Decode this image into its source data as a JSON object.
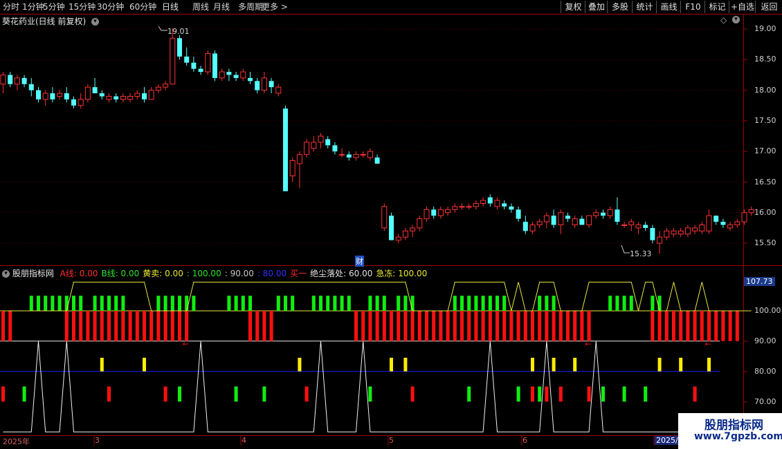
{
  "toolbar": {
    "left": [
      "分时",
      "1分钟",
      "5分钟",
      "15分钟",
      "30分钟",
      "60分钟",
      "日线",
      "周线",
      "月线",
      "多周期",
      "更多"
    ],
    "right": [
      "复权",
      "叠加",
      "多股",
      "统计",
      "画线",
      "F10",
      "标记",
      "+自选",
      "返回"
    ]
  },
  "stock": {
    "title": "葵花药业(日线 前复权)",
    "high_marker": "19.01",
    "low_marker": "15.33",
    "fin_marker": "财"
  },
  "price_axis": [
    "19.00",
    "18.50",
    "18.00",
    "17.50",
    "17.00",
    "16.50",
    "16.00",
    "15.50"
  ],
  "indicator": {
    "name": "股朋指标网",
    "fields": [
      {
        "label": "A线: 0.00",
        "color": "#ff3030"
      },
      {
        "label": "B线: 0.00",
        "color": "#30e030"
      },
      {
        "label": "黄卖: 0.00",
        "color": "#e8e830"
      },
      {
        "label": ": 100.00",
        "color": "#30e030"
      },
      {
        "label": ": 90.00",
        "color": "#c8c8c8"
      },
      {
        "label": ": 80.00",
        "color": "#3030ff"
      },
      {
        "label": "买一",
        "color": "#ff3030"
      },
      {
        "label": "绝尘落处: 60.00",
        "color": "#e0e0e0"
      },
      {
        "label": "急冻: 100.00",
        "color": "#e8e830"
      }
    ],
    "axis": [
      "107.73",
      "100.00",
      "90.00",
      "80.00",
      "70.00"
    ],
    "arrow_glyph": "←"
  },
  "dates": [
    "2025年",
    "3",
    "4",
    "5",
    "6",
    "2025/0"
  ],
  "watermark": {
    "line1": "股朋指标网",
    "line2": "www.7gpzb.com"
  },
  "colors": {
    "up": "#ff3333",
    "down": "#54ffff",
    "frame": "#a00000",
    "red": "#ff1010",
    "green": "#10ee10",
    "yellow": "#ffee00",
    "blue": "#2020ff"
  },
  "chart_data": {
    "type": "candlestick",
    "candles": [
      {
        "o": 18.1,
        "h": 18.3,
        "l": 17.95,
        "c": 18.25
      },
      {
        "o": 18.25,
        "h": 18.3,
        "l": 18.05,
        "c": 18.1
      },
      {
        "o": 18.1,
        "h": 18.25,
        "l": 18.0,
        "c": 18.2
      },
      {
        "o": 18.2,
        "h": 18.25,
        "l": 18.05,
        "c": 18.1
      },
      {
        "o": 18.1,
        "h": 18.2,
        "l": 17.9,
        "c": 18.0
      },
      {
        "o": 18.0,
        "h": 18.05,
        "l": 17.8,
        "c": 17.85
      },
      {
        "o": 17.85,
        "h": 18.0,
        "l": 17.75,
        "c": 17.95
      },
      {
        "o": 17.95,
        "h": 18.05,
        "l": 17.8,
        "c": 17.85
      },
      {
        "o": 17.9,
        "h": 18.0,
        "l": 17.85,
        "c": 17.95
      },
      {
        "o": 17.95,
        "h": 18.05,
        "l": 17.8,
        "c": 17.85
      },
      {
        "o": 17.85,
        "h": 17.9,
        "l": 17.7,
        "c": 17.75
      },
      {
        "o": 17.75,
        "h": 17.95,
        "l": 17.7,
        "c": 17.85
      },
      {
        "o": 17.85,
        "h": 18.1,
        "l": 17.8,
        "c": 18.05
      },
      {
        "o": 18.05,
        "h": 18.2,
        "l": 17.95,
        "c": 17.95
      },
      {
        "o": 17.95,
        "h": 18.0,
        "l": 17.85,
        "c": 17.9
      },
      {
        "o": 17.85,
        "h": 17.95,
        "l": 17.8,
        "c": 17.9
      },
      {
        "o": 17.9,
        "h": 17.95,
        "l": 17.8,
        "c": 17.85
      },
      {
        "o": 17.85,
        "h": 17.95,
        "l": 17.8,
        "c": 17.9
      },
      {
        "o": 17.85,
        "h": 17.95,
        "l": 17.8,
        "c": 17.9
      },
      {
        "o": 17.9,
        "h": 18.0,
        "l": 17.85,
        "c": 17.95
      },
      {
        "o": 17.95,
        "h": 18.05,
        "l": 17.8,
        "c": 17.85
      },
      {
        "o": 17.85,
        "h": 18.05,
        "l": 17.85,
        "c": 18.0
      },
      {
        "o": 18.0,
        "h": 18.1,
        "l": 17.95,
        "c": 18.05
      },
      {
        "o": 18.05,
        "h": 18.15,
        "l": 18.0,
        "c": 18.1
      },
      {
        "o": 18.1,
        "h": 19.01,
        "l": 18.1,
        "c": 18.85
      },
      {
        "o": 18.85,
        "h": 18.9,
        "l": 18.5,
        "c": 18.55
      },
      {
        "o": 18.55,
        "h": 18.7,
        "l": 18.4,
        "c": 18.45
      },
      {
        "o": 18.45,
        "h": 18.55,
        "l": 18.3,
        "c": 18.35
      },
      {
        "o": 18.35,
        "h": 18.4,
        "l": 18.25,
        "c": 18.3
      },
      {
        "o": 18.3,
        "h": 18.65,
        "l": 18.25,
        "c": 18.6
      },
      {
        "o": 18.6,
        "h": 18.65,
        "l": 18.15,
        "c": 18.2
      },
      {
        "o": 18.2,
        "h": 18.35,
        "l": 18.15,
        "c": 18.3
      },
      {
        "o": 18.3,
        "h": 18.35,
        "l": 18.15,
        "c": 18.25
      },
      {
        "o": 18.25,
        "h": 18.3,
        "l": 18.15,
        "c": 18.2
      },
      {
        "o": 18.2,
        "h": 18.35,
        "l": 18.15,
        "c": 18.3
      },
      {
        "o": 18.2,
        "h": 18.3,
        "l": 18.1,
        "c": 18.15
      },
      {
        "o": 18.15,
        "h": 18.2,
        "l": 17.95,
        "c": 18.0
      },
      {
        "o": 18.0,
        "h": 18.3,
        "l": 17.95,
        "c": 18.2
      },
      {
        "o": 18.15,
        "h": 18.2,
        "l": 17.95,
        "c": 18.05
      },
      {
        "o": 17.95,
        "h": 18.1,
        "l": 17.9,
        "c": 18.05
      },
      {
        "o": 17.7,
        "h": 17.75,
        "l": 16.35,
        "c": 16.35
      },
      {
        "o": 16.6,
        "h": 16.9,
        "l": 16.5,
        "c": 16.85
      },
      {
        "o": 16.8,
        "h": 17.0,
        "l": 16.4,
        "c": 16.95
      },
      {
        "o": 16.95,
        "h": 17.2,
        "l": 16.9,
        "c": 17.15
      },
      {
        "o": 17.05,
        "h": 17.25,
        "l": 17.0,
        "c": 17.15
      },
      {
        "o": 17.15,
        "h": 17.3,
        "l": 17.05,
        "c": 17.25
      },
      {
        "o": 17.2,
        "h": 17.25,
        "l": 17.05,
        "c": 17.1
      },
      {
        "o": 17.1,
        "h": 17.15,
        "l": 16.95,
        "c": 17.0
      },
      {
        "o": 16.95,
        "h": 17.05,
        "l": 16.9,
        "c": 16.95
      },
      {
        "o": 16.95,
        "h": 17.0,
        "l": 16.85,
        "c": 16.9
      },
      {
        "o": 16.9,
        "h": 17.0,
        "l": 16.85,
        "c": 16.95
      },
      {
        "o": 16.95,
        "h": 17.0,
        "l": 16.9,
        "c": 16.95
      },
      {
        "o": 16.9,
        "h": 17.05,
        "l": 16.85,
        "c": 17.0
      },
      {
        "o": 16.9,
        "h": 16.95,
        "l": 16.8,
        "c": 16.8
      },
      {
        "o": 15.75,
        "h": 16.15,
        "l": 15.7,
        "c": 16.1
      },
      {
        "o": 15.95,
        "h": 16.0,
        "l": 15.55,
        "c": 15.55
      },
      {
        "o": 15.55,
        "h": 15.65,
        "l": 15.5,
        "c": 15.6
      },
      {
        "o": 15.6,
        "h": 15.75,
        "l": 15.55,
        "c": 15.7
      },
      {
        "o": 15.7,
        "h": 15.8,
        "l": 15.6,
        "c": 15.75
      },
      {
        "o": 15.75,
        "h": 15.95,
        "l": 15.7,
        "c": 15.9
      },
      {
        "o": 15.9,
        "h": 16.1,
        "l": 15.85,
        "c": 16.05
      },
      {
        "o": 16.05,
        "h": 16.1,
        "l": 15.9,
        "c": 15.95
      },
      {
        "o": 15.95,
        "h": 16.1,
        "l": 15.9,
        "c": 16.05
      },
      {
        "o": 16.0,
        "h": 16.1,
        "l": 15.95,
        "c": 16.05
      },
      {
        "o": 16.05,
        "h": 16.15,
        "l": 16.0,
        "c": 16.1
      },
      {
        "o": 16.1,
        "h": 16.15,
        "l": 16.05,
        "c": 16.1
      },
      {
        "o": 16.1,
        "h": 16.15,
        "l": 16.05,
        "c": 16.1
      },
      {
        "o": 16.1,
        "h": 16.2,
        "l": 16.05,
        "c": 16.15
      },
      {
        "o": 16.15,
        "h": 16.25,
        "l": 16.1,
        "c": 16.2
      },
      {
        "o": 16.25,
        "h": 16.3,
        "l": 16.1,
        "c": 16.15
      },
      {
        "o": 16.1,
        "h": 16.25,
        "l": 16.05,
        "c": 16.2
      },
      {
        "o": 16.15,
        "h": 16.2,
        "l": 16.05,
        "c": 16.1
      },
      {
        "o": 16.1,
        "h": 16.15,
        "l": 16.0,
        "c": 16.05
      },
      {
        "o": 16.05,
        "h": 16.1,
        "l": 15.85,
        "c": 15.9
      },
      {
        "o": 15.85,
        "h": 15.95,
        "l": 15.65,
        "c": 15.7
      },
      {
        "o": 15.7,
        "h": 15.85,
        "l": 15.65,
        "c": 15.8
      },
      {
        "o": 15.8,
        "h": 15.9,
        "l": 15.75,
        "c": 15.85
      },
      {
        "o": 15.85,
        "h": 16.0,
        "l": 15.75,
        "c": 15.95
      },
      {
        "o": 15.95,
        "h": 16.05,
        "l": 15.75,
        "c": 15.8
      },
      {
        "o": 15.8,
        "h": 16.05,
        "l": 15.65,
        "c": 16.0
      },
      {
        "o": 15.95,
        "h": 16.0,
        "l": 15.85,
        "c": 15.9
      },
      {
        "o": 15.8,
        "h": 15.95,
        "l": 15.75,
        "c": 15.9
      },
      {
        "o": 15.9,
        "h": 15.95,
        "l": 15.8,
        "c": 15.8
      },
      {
        "o": 15.8,
        "h": 15.95,
        "l": 15.75,
        "c": 15.95
      },
      {
        "o": 15.95,
        "h": 16.05,
        "l": 15.9,
        "c": 16.0
      },
      {
        "o": 16.0,
        "h": 16.05,
        "l": 15.9,
        "c": 15.95
      },
      {
        "o": 15.95,
        "h": 16.1,
        "l": 15.9,
        "c": 16.05
      },
      {
        "o": 16.05,
        "h": 16.25,
        "l": 15.8,
        "c": 15.85
      },
      {
        "o": 15.8,
        "h": 15.85,
        "l": 15.75,
        "c": 15.8
      },
      {
        "o": 15.8,
        "h": 15.9,
        "l": 15.7,
        "c": 15.85
      },
      {
        "o": 15.75,
        "h": 15.85,
        "l": 15.65,
        "c": 15.8
      },
      {
        "o": 15.8,
        "h": 15.85,
        "l": 15.7,
        "c": 15.75
      },
      {
        "o": 15.75,
        "h": 15.8,
        "l": 15.5,
        "c": 15.55
      },
      {
        "o": 15.5,
        "h": 15.7,
        "l": 15.33,
        "c": 15.6
      },
      {
        "o": 15.6,
        "h": 15.75,
        "l": 15.55,
        "c": 15.7
      },
      {
        "o": 15.65,
        "h": 15.75,
        "l": 15.6,
        "c": 15.7
      },
      {
        "o": 15.65,
        "h": 15.75,
        "l": 15.6,
        "c": 15.7
      },
      {
        "o": 15.65,
        "h": 15.8,
        "l": 15.6,
        "c": 15.75
      },
      {
        "o": 15.7,
        "h": 15.8,
        "l": 15.65,
        "c": 15.75
      },
      {
        "o": 15.7,
        "h": 15.85,
        "l": 15.65,
        "c": 15.8
      },
      {
        "o": 15.7,
        "h": 16.05,
        "l": 15.65,
        "c": 15.95
      },
      {
        "o": 15.95,
        "h": 15.95,
        "l": 15.8,
        "c": 15.85
      },
      {
        "o": 15.85,
        "h": 15.9,
        "l": 15.75,
        "c": 15.8
      },
      {
        "o": 15.75,
        "h": 15.85,
        "l": 15.7,
        "c": 15.8
      },
      {
        "o": 15.8,
        "h": 15.9,
        "l": 15.75,
        "c": 15.85
      },
      {
        "o": 15.85,
        "h": 16.05,
        "l": 15.8,
        "c": 16.0
      },
      {
        "o": 16.0,
        "h": 16.1,
        "l": 15.95,
        "c": 16.05
      }
    ],
    "indicator_series": {
      "red_bars": [
        0,
        1,
        9,
        10,
        11,
        12,
        13,
        14,
        15,
        16,
        17,
        18,
        19,
        20,
        21,
        22,
        23,
        24,
        25,
        26,
        35,
        36,
        37,
        38,
        50,
        51,
        52,
        53,
        54,
        55,
        56,
        57,
        58,
        59,
        60,
        61,
        62,
        63,
        64,
        65,
        66,
        67,
        68,
        69,
        70,
        71,
        72,
        73,
        74,
        75,
        76,
        77,
        78,
        79,
        80,
        81,
        82,
        83,
        92,
        93,
        94,
        95,
        96,
        97,
        98,
        99,
        100,
        101,
        102,
        103,
        104
      ],
      "green_bars": [
        4,
        5,
        6,
        7,
        8,
        9,
        10,
        11,
        13,
        14,
        15,
        16,
        17,
        22,
        23,
        24,
        25,
        26,
        27,
        32,
        33,
        34,
        35,
        39,
        40,
        41,
        44,
        45,
        46,
        47,
        48,
        49,
        52,
        53,
        54,
        56,
        57,
        58,
        64,
        65,
        66,
        67,
        68,
        69,
        70,
        71,
        76,
        77,
        78,
        86,
        87,
        88,
        89,
        92,
        93
      ],
      "yellow_marks": [
        14,
        20,
        42,
        55,
        57,
        75,
        78,
        81,
        93,
        96,
        100
      ],
      "arrows": [
        26,
        83,
        100
      ]
    }
  }
}
